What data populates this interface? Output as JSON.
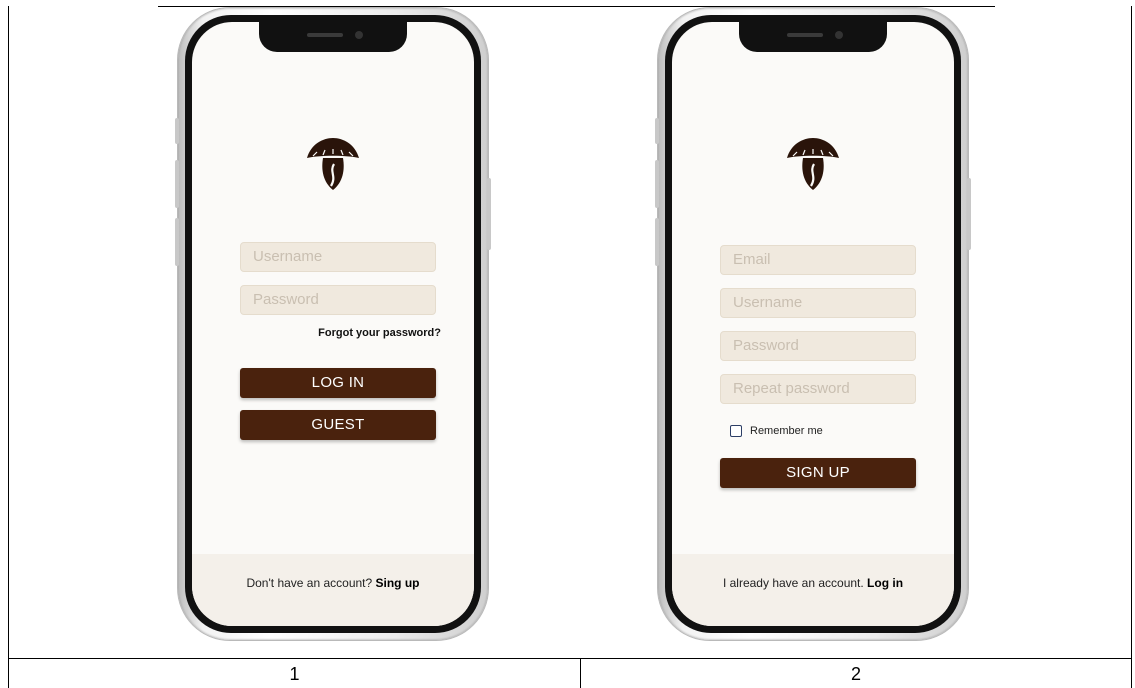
{
  "table": {
    "cells": [
      {
        "number": "1"
      },
      {
        "number": "2"
      }
    ]
  },
  "login_screen": {
    "logo_icon": "mushroom-coffee-bean-icon",
    "username_placeholder": "Username",
    "password_placeholder": "Password",
    "forgot_password": "Forgot your password?",
    "login_button": "LOG IN",
    "guest_button": "GUEST",
    "footer_text": "Don't have an account? ",
    "footer_link": "Sing up"
  },
  "signup_screen": {
    "logo_icon": "mushroom-coffee-bean-icon",
    "email_placeholder": "Email",
    "username_placeholder": "Username",
    "password_placeholder": "Password",
    "repeat_password_placeholder": "Repeat password",
    "remember_me": "Remember me",
    "remember_me_checked": false,
    "signup_button": "SIGN UP",
    "footer_text": "I already have an account. ",
    "footer_link": "Log in"
  },
  "colors": {
    "brand_brown": "#4a220d",
    "field_fill": "#f0e9de",
    "screen_background": "#fbfaf8"
  }
}
